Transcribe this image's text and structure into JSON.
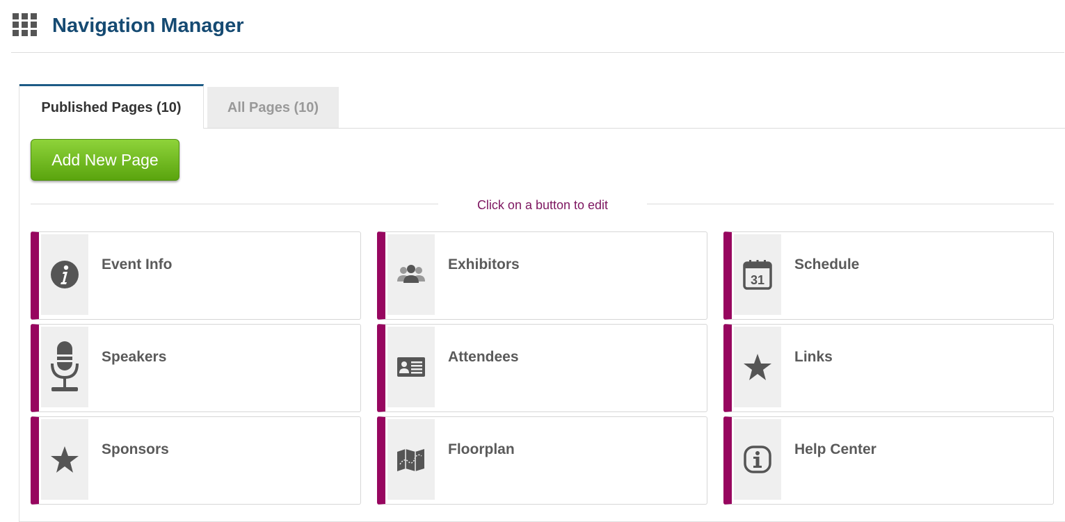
{
  "header": {
    "title": "Navigation Manager"
  },
  "tabs": [
    {
      "label": "Published Pages (10)",
      "active": true
    },
    {
      "label": "All Pages (10)",
      "active": false
    }
  ],
  "add_button": {
    "label": "Add New Page"
  },
  "hint": "Click on a button to edit",
  "accent_color": "#97065f",
  "pages": [
    {
      "label": "Event Info",
      "icon": "info-circle-icon"
    },
    {
      "label": "Exhibitors",
      "icon": "people-icon"
    },
    {
      "label": "Schedule",
      "icon": "calendar-icon",
      "icon_text": "31"
    },
    {
      "label": "Speakers",
      "icon": "microphone-icon"
    },
    {
      "label": "Attendees",
      "icon": "id-card-icon"
    },
    {
      "label": "Links",
      "icon": "star-icon"
    },
    {
      "label": "Sponsors",
      "icon": "star-icon"
    },
    {
      "label": "Floorplan",
      "icon": "map-icon"
    },
    {
      "label": "Help Center",
      "icon": "info-outline-icon"
    }
  ]
}
